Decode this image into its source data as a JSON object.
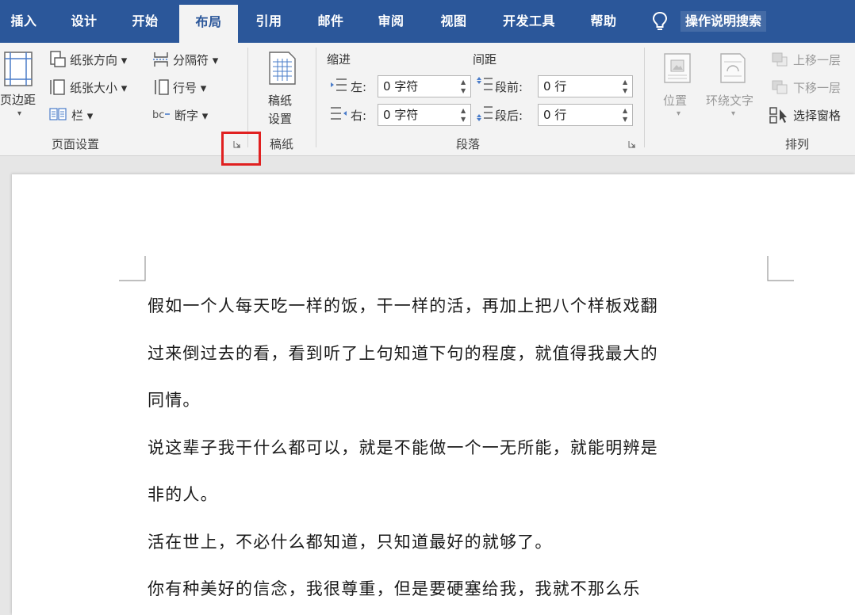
{
  "tabs": [
    {
      "label": "插入",
      "active": false
    },
    {
      "label": "设计",
      "active": false
    },
    {
      "label": "开始",
      "active": false
    },
    {
      "label": "布局",
      "active": true
    },
    {
      "label": "引用",
      "active": false
    },
    {
      "label": "邮件",
      "active": false
    },
    {
      "label": "审阅",
      "active": false
    },
    {
      "label": "视图",
      "active": false
    },
    {
      "label": "开发工具",
      "active": false
    },
    {
      "label": "帮助",
      "active": false
    }
  ],
  "tell_me": {
    "icon": "lightbulb-icon",
    "label": "操作说明搜索"
  },
  "page_setup": {
    "margins": "页边距",
    "orientation": "纸张方向",
    "size": "纸张大小",
    "columns": "栏",
    "breaks": "分隔符",
    "line_numbers": "行号",
    "hyphenation": "断字",
    "group_label": "页面设置"
  },
  "draft_paper": {
    "button_line1": "稿纸",
    "button_line2": "设置",
    "group_label": "稿纸"
  },
  "paragraph": {
    "indent_header": "缩进",
    "spacing_header": "间距",
    "left_label": "左:",
    "right_label": "右:",
    "before_label": "段前:",
    "after_label": "段后:",
    "left_value": "0 字符",
    "right_value": "0 字符",
    "before_value": "0 行",
    "after_value": "0 行",
    "group_label": "段落"
  },
  "arrange": {
    "position": "位置",
    "wrap_text": "环绕文字",
    "bring_forward": "上移一层",
    "send_backward": "下移一层",
    "selection_pane": "选择窗格",
    "group_label": "排列"
  },
  "document": {
    "lines": [
      "假如一个人每天吃一样的饭，干一样的活，再加上把八个样板戏翻",
      "过来倒过去的看，看到听了上句知道下句的程度，就值得我最大的",
      "同情。",
      "说这辈子我干什么都可以，就是不能做一个一无所能，就能明辨是",
      "非的人。",
      "活在世上，不必什么都知道，只知道最好的就够了。",
      "你有种美好的信念，我很尊重，但是要硬塞给我，我就不那么乐"
    ]
  },
  "colors": {
    "tab_bar": "#2b579a",
    "ribbon": "#f3f3f3",
    "highlight_box": "#e02020"
  }
}
